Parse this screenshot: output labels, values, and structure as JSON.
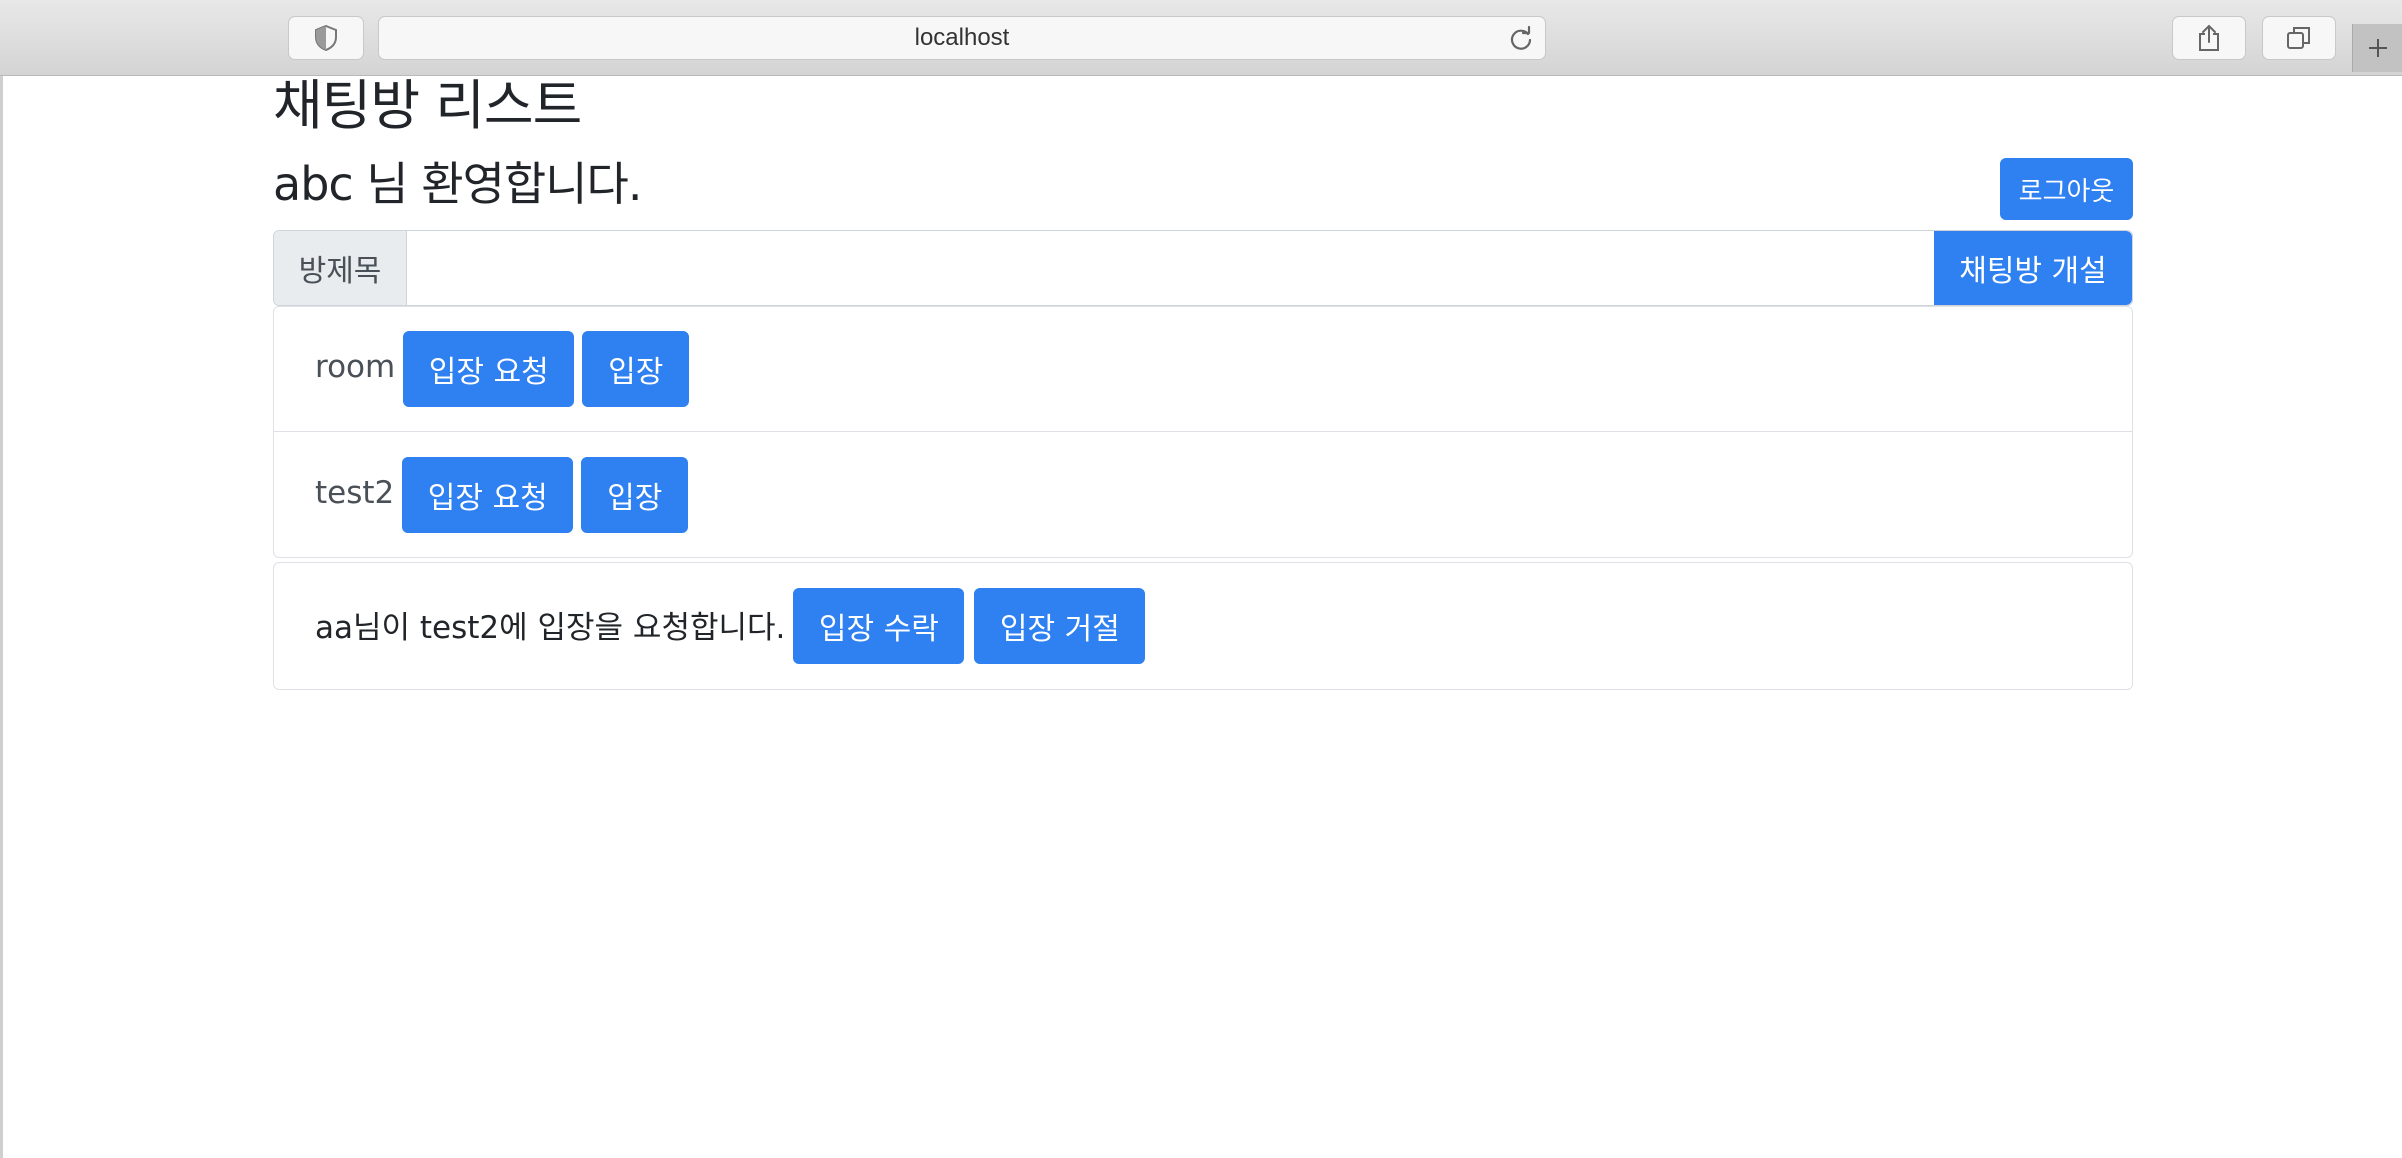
{
  "browser": {
    "url": "localhost"
  },
  "page": {
    "title": "채팅방 리스트",
    "welcome": "abc 님 환영합니다.",
    "logout_label": "로그아웃"
  },
  "create_room": {
    "label": "방제목",
    "value": "",
    "placeholder": "",
    "button_label": "채팅방 개설"
  },
  "rooms": [
    {
      "name": "room",
      "request_label": "입장 요청",
      "enter_label": "입장"
    },
    {
      "name": "test2",
      "request_label": "입장 요청",
      "enter_label": "입장"
    }
  ],
  "entry_request": {
    "message": "aa님이 test2에 입장을 요청합니다.",
    "accept_label": "입장 수락",
    "reject_label": "입장 거절"
  },
  "colors": {
    "primary": "#2f80f0",
    "border": "#dee2e6",
    "input_group_bg": "#e9ecef"
  }
}
